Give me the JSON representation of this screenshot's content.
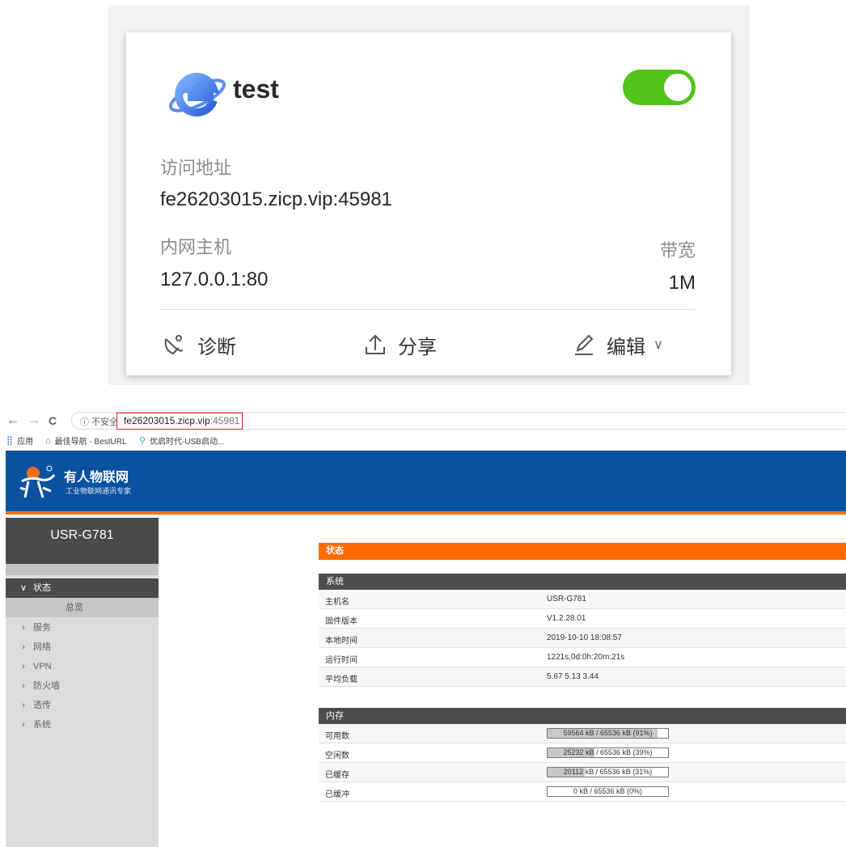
{
  "card": {
    "title": "test",
    "enabled": true,
    "toggle_color": "#52c41a",
    "access_label": "访问地址",
    "access_value": "fe26203015.zicp.vip:45981",
    "host_label": "内网主机",
    "host_value": "127.0.0.1:80",
    "bandwidth_label": "带宽",
    "bandwidth_value": "1M",
    "actions": {
      "diagnose": "诊断",
      "share": "分享",
      "edit": "编辑"
    }
  },
  "browser": {
    "back": "←",
    "forward": "→",
    "reload": "C",
    "security_label": "ⓘ 不安全",
    "url_host": "fe26203015.zicp.vip",
    "url_port": ":45981",
    "bookmarks": [
      "应用",
      "最佳导航 - BestURL",
      "优启时代-USB启动..."
    ]
  },
  "router": {
    "brand_title": "有人物联网",
    "brand_subtitle": "工业物联网通讯专家",
    "brand_color": "#0a52a0",
    "accent_color": "#ff6a00",
    "device_name": "USR-G781",
    "menu": [
      {
        "label": "状态",
        "expanded": true,
        "active": true
      },
      {
        "label": "总览",
        "sub": true
      },
      {
        "label": "服务"
      },
      {
        "label": "网络"
      },
      {
        "label": "VPN"
      },
      {
        "label": "防火墙"
      },
      {
        "label": "透传"
      },
      {
        "label": "系统"
      }
    ],
    "status_title": "状态",
    "system": {
      "title": "系统",
      "rows": [
        {
          "key": "主机名",
          "value": "USR-G781"
        },
        {
          "key": "固件版本",
          "value": "V1.2.28.01"
        },
        {
          "key": "本地时间",
          "value": "2019-10-10 18:08:57"
        },
        {
          "key": "运行时间",
          "value": "1221s,0d:0h:20m:21s"
        },
        {
          "key": "平均负载",
          "value": "5.67 5.13 3.44"
        }
      ]
    },
    "memory": {
      "title": "内存",
      "rows": [
        {
          "key": "可用数",
          "text": "59564 kB / 65536 kB (91%)",
          "percent": 91
        },
        {
          "key": "空闲数",
          "text": "25232 kB / 65536 kB (39%)",
          "percent": 39
        },
        {
          "key": "已缓存",
          "text": "20112 kB / 65536 kB (31%)",
          "percent": 31
        },
        {
          "key": "已缓冲",
          "text": "0 kB / 65536 kB (0%)",
          "percent": 0
        }
      ]
    }
  }
}
